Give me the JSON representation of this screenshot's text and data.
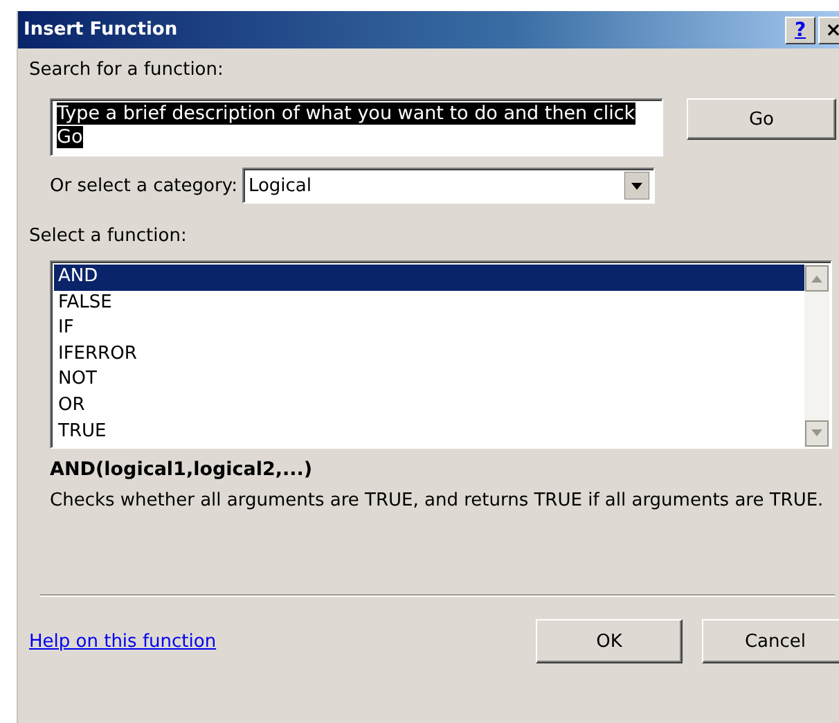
{
  "window": {
    "title": "Insert Function",
    "buttons": [
      {
        "kind": "help",
        "label": "?"
      },
      {
        "kind": "close",
        "label": "×"
      }
    ]
  },
  "search": {
    "label": "Search for a function:",
    "value": "Type a brief description of what you want to do and then click Go",
    "text_selected": true,
    "button": "Go"
  },
  "category": {
    "label": "Or select a category:",
    "value": "Logical"
  },
  "functions": {
    "label": "Select a function:",
    "items": [
      {
        "name": "AND",
        "selected": true
      },
      {
        "name": "FALSE",
        "selected": false
      },
      {
        "name": "IF",
        "selected": false
      },
      {
        "name": "IFERROR",
        "selected": false
      },
      {
        "name": "NOT",
        "selected": false
      },
      {
        "name": "OR",
        "selected": false
      },
      {
        "name": "TRUE",
        "selected": false
      }
    ]
  },
  "signature": "AND(logical1,logical2,...)",
  "description": "Checks whether all arguments are TRUE, and returns TRUE if all arguments are TRUE.",
  "help_link": "Help on this function",
  "buttons": [
    "OK",
    "Cancel"
  ]
}
